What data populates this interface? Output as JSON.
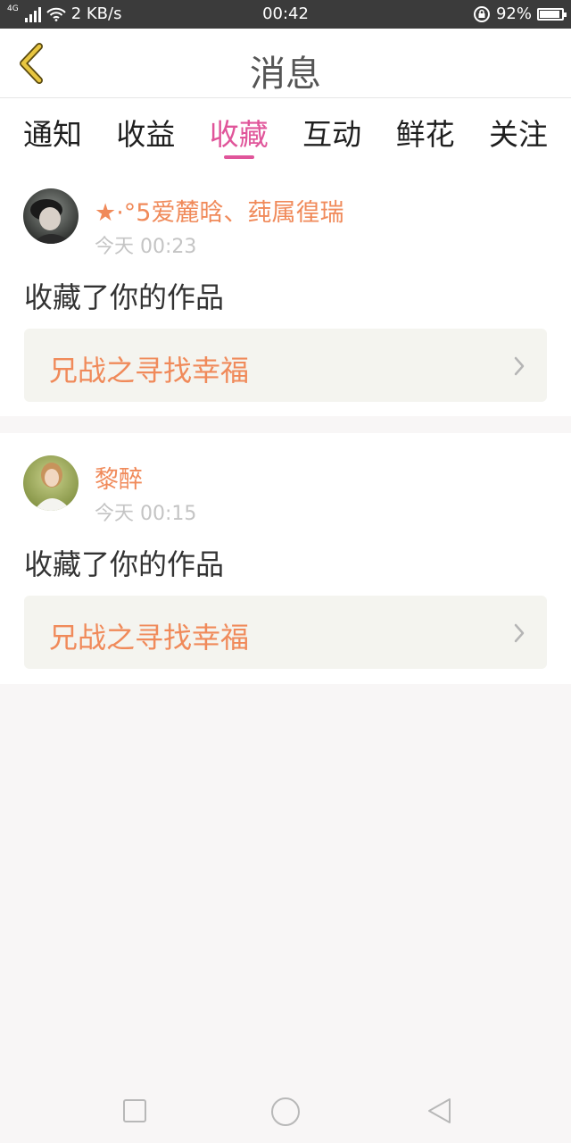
{
  "status_bar": {
    "network_label": "4G",
    "speed": "2 KB/s",
    "time": "00:42",
    "battery": "92%",
    "battery_level": 0.92,
    "icons": [
      "signal-icon",
      "wifi-icon",
      "rotation-lock-icon",
      "battery-icon"
    ]
  },
  "header": {
    "title": "消息",
    "back_icon": "chevron-left-icon"
  },
  "tabs": [
    {
      "label": "通知",
      "active": false
    },
    {
      "label": "收益",
      "active": false
    },
    {
      "label": "收藏",
      "active": true
    },
    {
      "label": "互动",
      "active": false
    },
    {
      "label": "鲜花",
      "active": false
    },
    {
      "label": "关注",
      "active": false
    }
  ],
  "messages": [
    {
      "user": "★·°5爱麓晗、莼属徨瑞",
      "time": "今天 00:23",
      "action": "收藏了你的作品",
      "work_title": "兄战之寻找幸福"
    },
    {
      "user": "黎醉",
      "time": "今天 00:15",
      "action": "收藏了你的作品",
      "work_title": "兄战之寻找幸福"
    }
  ],
  "colors": {
    "accent": "#e0559a",
    "name": "#f08a5a",
    "back_icon": "#e8c640"
  }
}
